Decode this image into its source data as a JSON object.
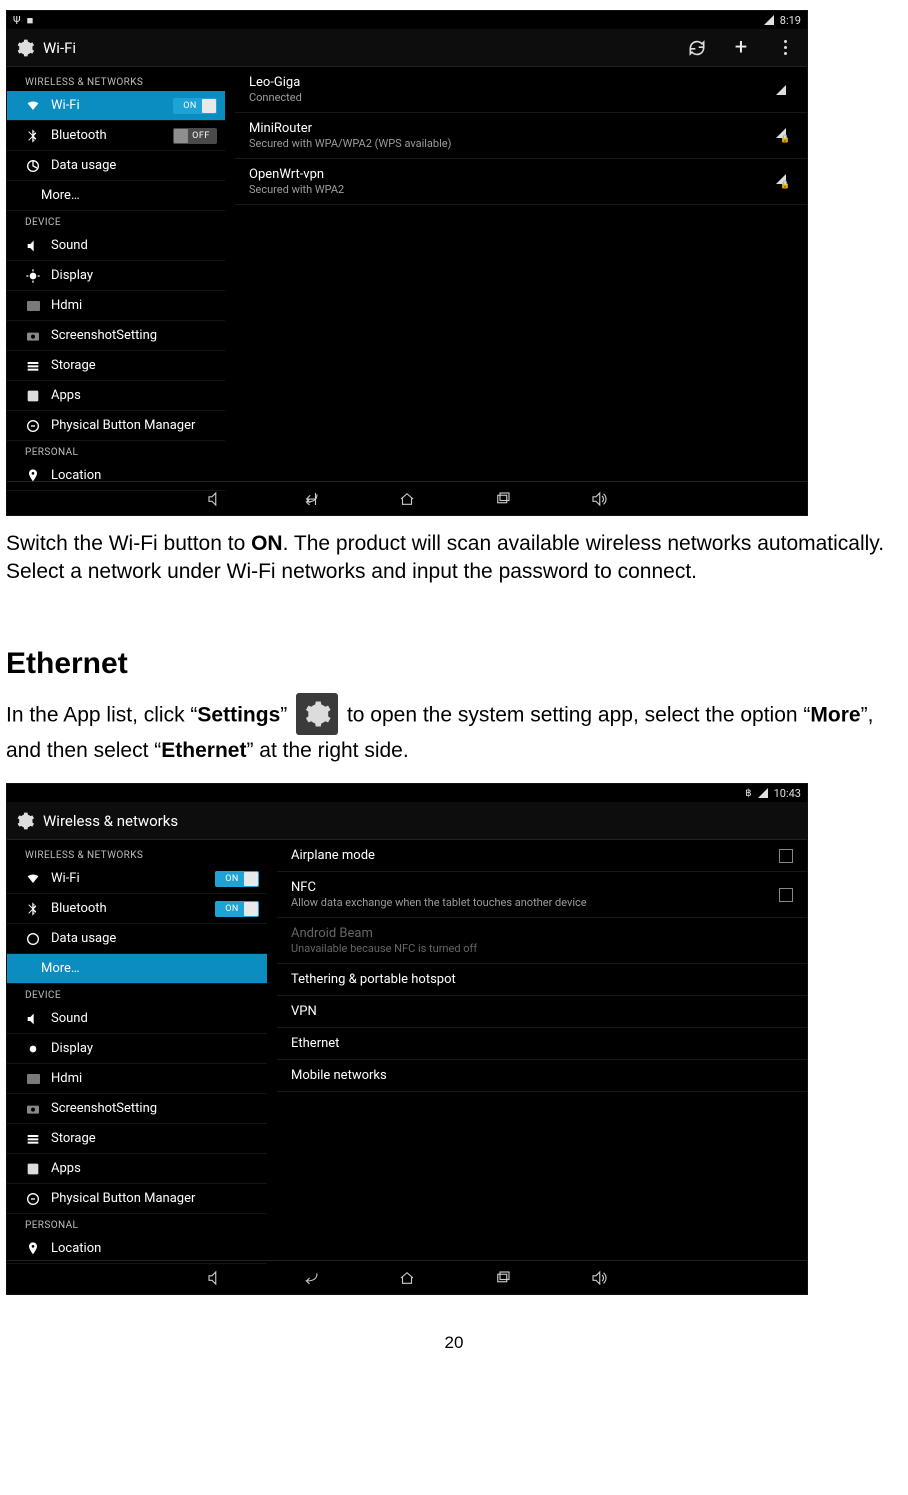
{
  "pageNumber": "20",
  "para1_pre": "Switch the Wi-Fi button to ",
  "para1_on": "ON",
  "para1_post": ". The product will scan available wireless networks automatically. Select a network under Wi-Fi networks and input the password to connect.",
  "heading": "Ethernet",
  "para2_a": "In the App list, click “",
  "para2_settings": "Settings",
  "para2_b": "”",
  "para2_c": "to open the system setting app, select the option “",
  "para2_more": "More",
  "para2_d": "”, and then select “",
  "para2_ethernet": "Ethernet",
  "para2_e": "” at the right side.",
  "tablet1": {
    "status": {
      "left_icons": "ψ",
      "time": "8:19"
    },
    "appbar": {
      "title": "Wi-Fi"
    },
    "sections": {
      "wireless": "WIRELESS & NETWORKS",
      "device": "DEVICE",
      "personal": "PERSONAL"
    },
    "nav": {
      "wifi": {
        "label": "Wi-Fi",
        "toggle": "ON"
      },
      "bluetooth": {
        "label": "Bluetooth",
        "toggle": "OFF"
      },
      "data": "Data usage",
      "more": "More…",
      "sound": "Sound",
      "display": "Display",
      "hdmi": "Hdmi",
      "sshot": "ScreenshotSetting",
      "storage": "Storage",
      "apps": "Apps",
      "pbm": "Physical Button Manager",
      "location": "Location"
    },
    "nets": [
      {
        "name": "Leo-Giga",
        "sub": "Connected",
        "locked": false
      },
      {
        "name": "MiniRouter",
        "sub": "Secured with WPA/WPA2 (WPS available)",
        "locked": true
      },
      {
        "name": "OpenWrt-vpn",
        "sub": "Secured with WPA2",
        "locked": true
      }
    ]
  },
  "tablet2": {
    "status": {
      "time": "10:43"
    },
    "appbar": {
      "title": "Wireless & networks"
    },
    "sections": {
      "wireless": "WIRELESS & NETWORKS",
      "device": "DEVICE",
      "personal": "PERSONAL"
    },
    "nav": {
      "wifi": {
        "label": "Wi-Fi",
        "toggle": "ON"
      },
      "bluetooth": {
        "label": "Bluetooth",
        "toggle": "ON"
      },
      "data": "Data usage",
      "more": "More…",
      "sound": "Sound",
      "display": "Display",
      "hdmi": "Hdmi",
      "sshot": "ScreenshotSetting",
      "storage": "Storage",
      "apps": "Apps",
      "pbm": "Physical Button Manager",
      "location": "Location"
    },
    "options": {
      "airplane": "Airplane mode",
      "nfc": "NFC",
      "nfc_sub": "Allow data exchange when the tablet touches another device",
      "beam": "Android Beam",
      "beam_sub": "Unavailable because NFC is turned off",
      "tether": "Tethering & portable hotspot",
      "vpn": "VPN",
      "eth": "Ethernet",
      "mobile": "Mobile networks"
    }
  }
}
